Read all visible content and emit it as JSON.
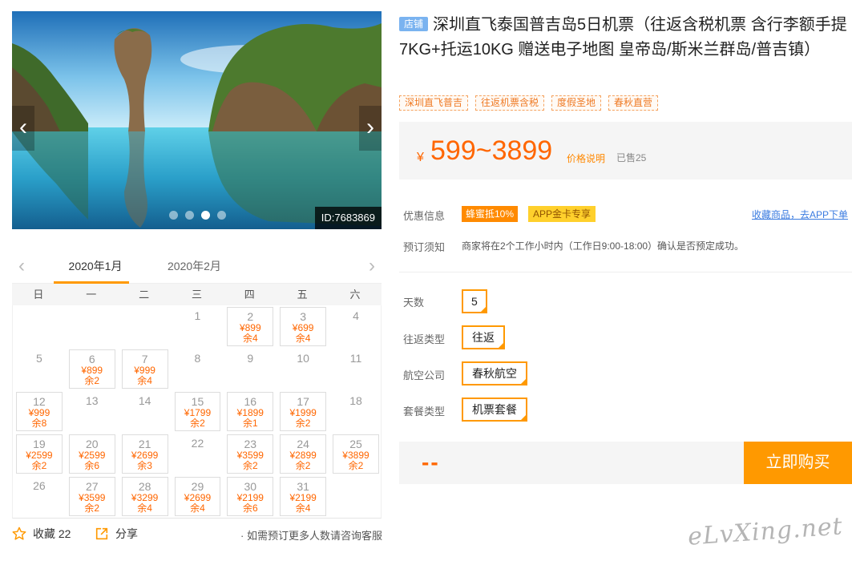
{
  "hero": {
    "prev_arrow": "‹",
    "next_arrow": "›",
    "id_label": "ID:7683869",
    "slide_count": 4,
    "active_slide": 3
  },
  "calendar": {
    "prev": "‹",
    "next": "›",
    "months": [
      "2020年1月",
      "2020年2月"
    ],
    "weekdays": [
      "日",
      "一",
      "二",
      "三",
      "四",
      "五",
      "六"
    ],
    "days": [
      {
        "d": "",
        "p": "",
        "s": ""
      },
      {
        "d": "",
        "p": "",
        "s": ""
      },
      {
        "d": "",
        "p": "",
        "s": ""
      },
      {
        "d": "1",
        "p": "",
        "s": ""
      },
      {
        "d": "2",
        "p": "¥899",
        "s": "余4"
      },
      {
        "d": "3",
        "p": "¥699",
        "s": "余4"
      },
      {
        "d": "4",
        "p": "",
        "s": ""
      },
      {
        "d": "5",
        "p": "",
        "s": ""
      },
      {
        "d": "6",
        "p": "¥899",
        "s": "余2"
      },
      {
        "d": "7",
        "p": "¥999",
        "s": "余4"
      },
      {
        "d": "8",
        "p": "",
        "s": ""
      },
      {
        "d": "9",
        "p": "",
        "s": ""
      },
      {
        "d": "10",
        "p": "",
        "s": ""
      },
      {
        "d": "11",
        "p": "",
        "s": ""
      },
      {
        "d": "12",
        "p": "¥999",
        "s": "余8"
      },
      {
        "d": "13",
        "p": "",
        "s": ""
      },
      {
        "d": "14",
        "p": "",
        "s": ""
      },
      {
        "d": "15",
        "p": "¥1799",
        "s": "余2"
      },
      {
        "d": "16",
        "p": "¥1899",
        "s": "余1"
      },
      {
        "d": "17",
        "p": "¥1999",
        "s": "余2"
      },
      {
        "d": "18",
        "p": "",
        "s": ""
      },
      {
        "d": "19",
        "p": "¥2599",
        "s": "余2"
      },
      {
        "d": "20",
        "p": "¥2599",
        "s": "余6"
      },
      {
        "d": "21",
        "p": "¥2699",
        "s": "余3"
      },
      {
        "d": "22",
        "p": "",
        "s": ""
      },
      {
        "d": "23",
        "p": "¥3599",
        "s": "余2"
      },
      {
        "d": "24",
        "p": "¥2899",
        "s": "余2"
      },
      {
        "d": "25",
        "p": "¥3899",
        "s": "余2"
      },
      {
        "d": "26",
        "p": "",
        "s": ""
      },
      {
        "d": "27",
        "p": "¥3599",
        "s": "余2"
      },
      {
        "d": "28",
        "p": "¥3299",
        "s": "余4"
      },
      {
        "d": "29",
        "p": "¥2699",
        "s": "余4"
      },
      {
        "d": "30",
        "p": "¥2199",
        "s": "余6"
      },
      {
        "d": "31",
        "p": "¥2199",
        "s": "余4"
      },
      {
        "d": "",
        "p": "",
        "s": ""
      }
    ]
  },
  "footer": {
    "favorite": "收藏 22",
    "share": "分享",
    "note": "· 如需预订更多人数请咨询客服"
  },
  "product": {
    "shop_badge": "店铺",
    "title": "深圳直飞泰国普吉岛5日机票（往返含税机票 含行李额手提7KG+托运10KG 赠送电子地图 皇帝岛/斯米兰群岛/普吉镇）",
    "tags": [
      "深圳直飞普吉",
      "往返机票含税",
      "度假圣地",
      "春秋直营"
    ],
    "currency": "¥",
    "price_range": "599~3899",
    "price_explain": "价格说明",
    "sold": "已售25",
    "promo_label": "优惠信息",
    "promo_badge_1": "蜂蜜抵10%",
    "promo_badge_2": "APP金卡专享",
    "app_link": "收藏商品，去APP下单",
    "notice_label": "预订须知",
    "notice_text": "商家将在2个工作小时内（工作日9:00-18:00）确认是否预定成功。",
    "options": [
      {
        "label": "天数",
        "value": "5"
      },
      {
        "label": "往返类型",
        "value": "往返"
      },
      {
        "label": "航空公司",
        "value": "春秋航空"
      },
      {
        "label": "套餐类型",
        "value": "机票套餐"
      }
    ],
    "total": "--",
    "buy_label": "立即购买"
  },
  "watermark": "eLvXing.net",
  "colors": {
    "accent": "#ff9900",
    "price": "#ff6600",
    "link": "#3a7be0",
    "shop_badge": "#7ab3f0"
  }
}
